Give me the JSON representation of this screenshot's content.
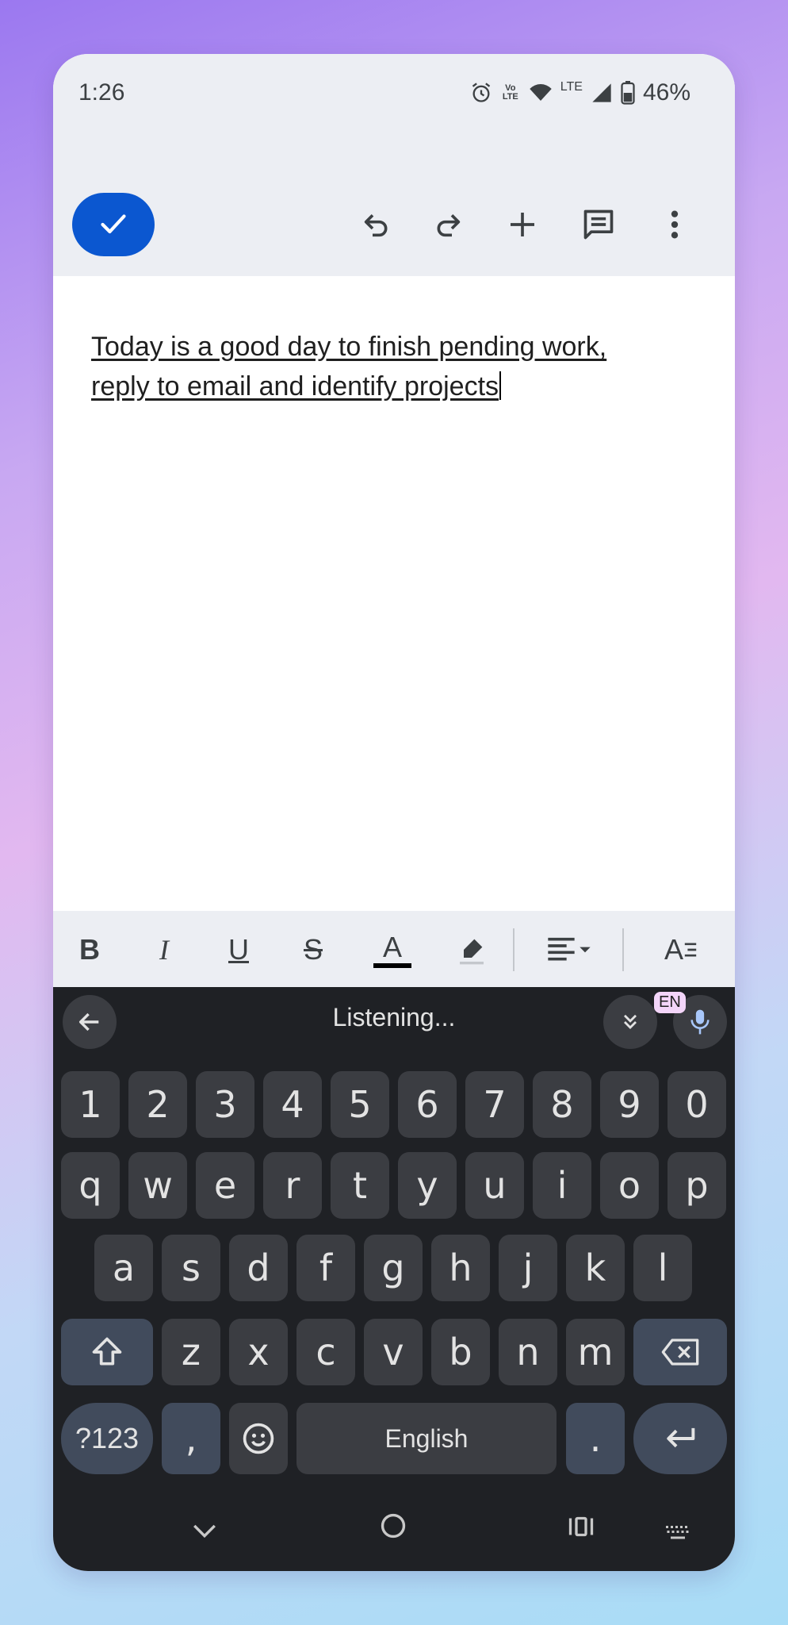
{
  "status": {
    "time": "1:26",
    "volte": "Vo LTE",
    "lte": "LTE",
    "battery": "46%"
  },
  "toolbar": {
    "done_label": "✓",
    "undo": "undo-icon",
    "redo": "redo-icon",
    "add": "plus-icon",
    "comment": "comment-icon",
    "more": "more-vert-icon"
  },
  "document": {
    "line1": "Today is a good day to finish pending work,",
    "line2": "reply to email and identify projects"
  },
  "format": {
    "bold": "B",
    "italic": "I",
    "underline": "U",
    "strike": "S",
    "text_color": "A",
    "style_label": "A"
  },
  "keyboard": {
    "status": "Listening...",
    "lang_badge": "EN",
    "numbers": [
      "1",
      "2",
      "3",
      "4",
      "5",
      "6",
      "7",
      "8",
      "9",
      "0"
    ],
    "row1": [
      "q",
      "w",
      "e",
      "r",
      "t",
      "y",
      "u",
      "i",
      "o",
      "p"
    ],
    "row2": [
      "a",
      "s",
      "d",
      "f",
      "g",
      "h",
      "j",
      "k",
      "l"
    ],
    "row3": [
      "z",
      "x",
      "c",
      "v",
      "b",
      "n",
      "m"
    ],
    "symbols": "?123",
    "comma": ",",
    "space": "English",
    "period": "."
  },
  "colors": {
    "accent": "#0b57d0",
    "keyboard_bg": "#1f2125",
    "key": "#3b3d42"
  }
}
